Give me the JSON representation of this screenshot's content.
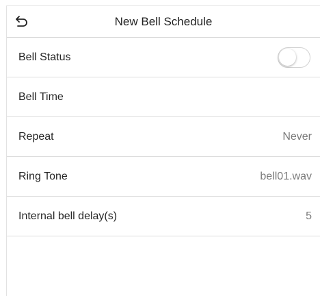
{
  "header": {
    "title": "New Bell Schedule",
    "back_icon": "back-arrow-icon"
  },
  "settings": {
    "bell_status": {
      "label": "Bell Status",
      "enabled": false
    },
    "bell_time": {
      "label": "Bell Time",
      "value": ""
    },
    "repeat": {
      "label": "Repeat",
      "value": "Never"
    },
    "ring_tone": {
      "label": "Ring Tone",
      "value": "bell01.wav"
    },
    "internal_bell_delay": {
      "label": "Internal bell delay(s)",
      "value": "5"
    }
  },
  "colors": {
    "divider": "#dcdcdc",
    "label_text": "#262626",
    "value_text": "#7a7a7a"
  }
}
